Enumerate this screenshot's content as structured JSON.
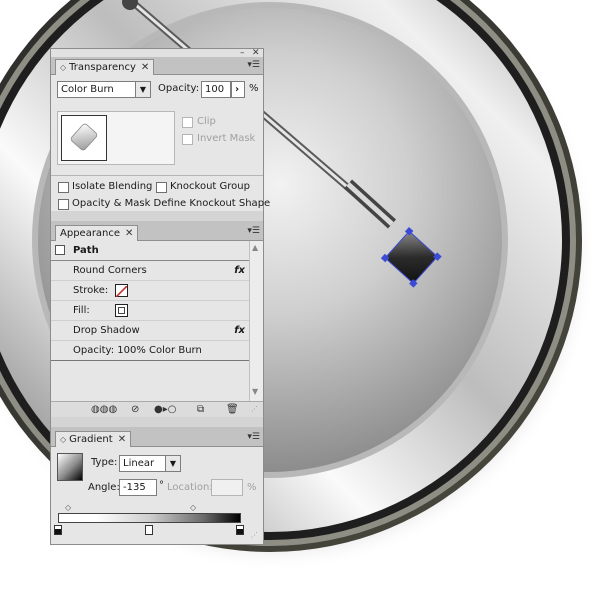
{
  "transparency": {
    "tab_label": "Transparency",
    "blend_mode": "Color Burn",
    "opacity_label": "Opacity:",
    "opacity_value": "100",
    "opacity_unit": "%",
    "clip_label": "Clip",
    "invert_mask_label": "Invert Mask",
    "isolate_blending_label": "Isolate Blending",
    "knockout_group_label": "Knockout Group",
    "opacity_mask_label": "Opacity & Mask Define Knockout Shape"
  },
  "appearance": {
    "tab_label": "Appearance",
    "rows": [
      {
        "label": "Path"
      },
      {
        "label": "Round Corners",
        "fx": "fx"
      },
      {
        "label": "Stroke:"
      },
      {
        "label": "Fill:"
      },
      {
        "label": "Drop Shadow",
        "fx": "fx"
      },
      {
        "label": "Opacity: 100% Color Burn"
      }
    ]
  },
  "gradient": {
    "tab_label": "Gradient",
    "type_label": "Type:",
    "type_value": "Linear",
    "angle_label": "Angle:",
    "angle_value": "-135",
    "degree_symbol": "°",
    "location_label": "Location:",
    "location_unit": "%"
  },
  "colors": {
    "panel_bg": "#e6e6e6",
    "tab_bar_bg": "#c2c2c2",
    "stroke_swatch": "#c4302b",
    "selection_outline": "#3b4bd6"
  },
  "icons": [
    "close-icon",
    "panel-menu-icon",
    "dropdown-arrow-icon",
    "fx-icon",
    "new-art-icon",
    "clear-appearance-icon",
    "reduce-basic-icon",
    "duplicate-item-icon",
    "delete-item-icon",
    "resize-grip-icon",
    "gradient-stop-icon",
    "midpoint-diamond-icon"
  ]
}
